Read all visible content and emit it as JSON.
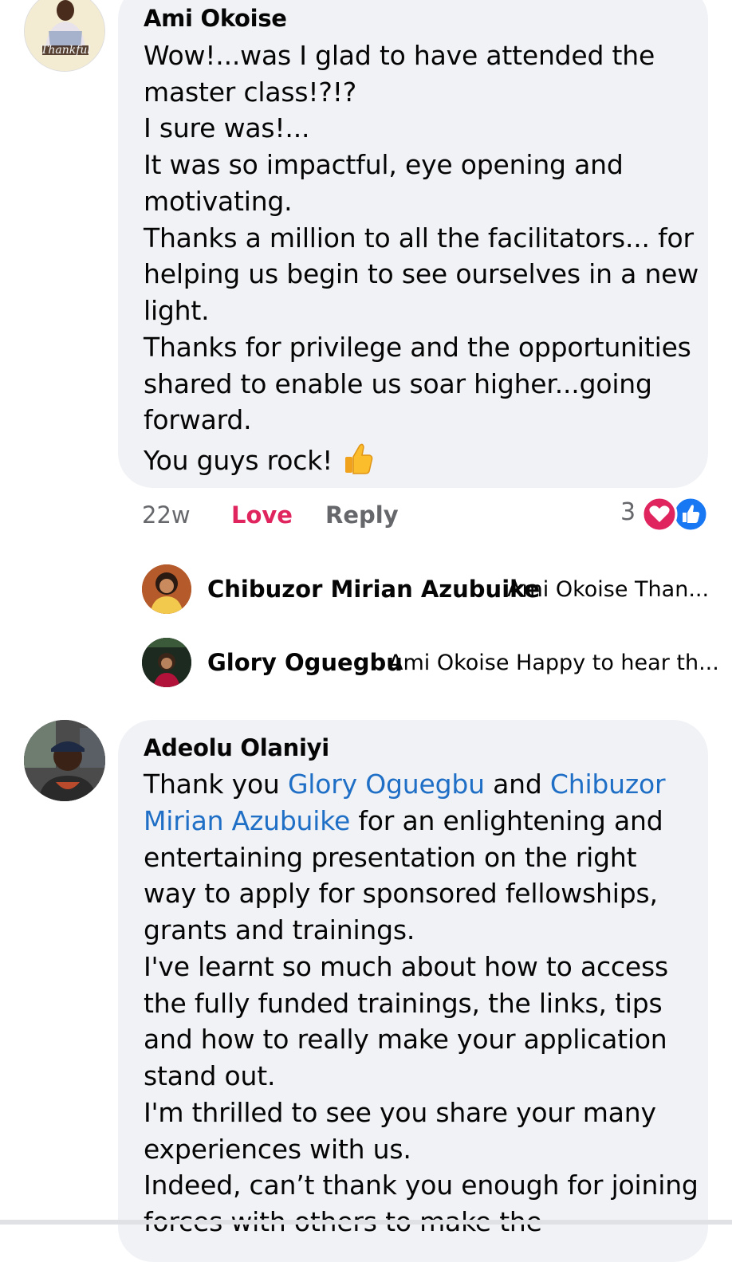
{
  "comment1": {
    "author": "Ami Okoise",
    "avatar_text": "Thankful",
    "lines": [
      "Wow!...was I glad to have attended the",
      "master class!?!?",
      "I sure was!...",
      "It was so impactful, eye opening and",
      "motivating.",
      "Thanks a million to all the facilitators... for",
      "helping us begin to see ourselves in a new",
      "light.",
      "Thanks for privilege and the opportunities",
      "shared to enable us soar higher...going",
      "forward.",
      "You guys rock!"
    ],
    "time": "22w",
    "love_label": "Love",
    "reply_label": "Reply",
    "reaction_count": "3",
    "love_color": "#e0245e",
    "like_color": "#1877f2"
  },
  "replies": [
    {
      "name": "Chibuzor Mirian Azubuike",
      "snippet": "Ami Okoise Than..."
    },
    {
      "name": "Glory Oguegbu",
      "snippet": "Ami Okoise Happy to hear th..."
    }
  ],
  "comment2": {
    "author": "Adeolu Olaniyi",
    "line1_a": "Thank you ",
    "mention1": "Glory Oguegbu",
    "line1_b": " and ",
    "mention2a": "Chibuzor",
    "mention2b": "Mirian Azubuike",
    "line2_b": " for an enlightening and",
    "lines": [
      "entertaining presentation on the right",
      "way to apply for sponsored fellowships,",
      "grants and trainings.",
      "I've learnt so much about how to access",
      "the fully funded trainings, the links, tips",
      "and how to really make your application",
      "stand out.",
      "I'm thrilled to see you share your many",
      "experiences with us.",
      "Indeed, can’t thank you enough for joining",
      "forces with others to make the"
    ]
  },
  "colors": {
    "bubble": "#f0f2f5",
    "mention": "#1f6fc6",
    "meta": "#65676b",
    "love": "#e0245e"
  }
}
